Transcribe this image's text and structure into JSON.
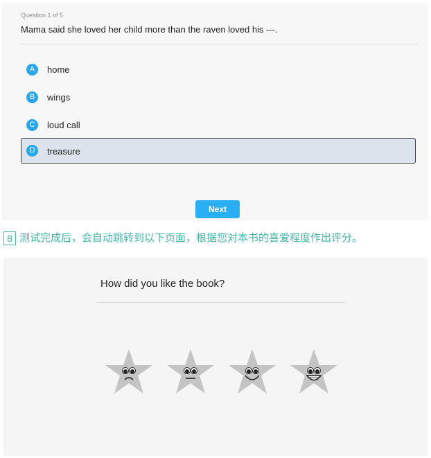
{
  "quiz": {
    "counter": "Question 1 of 5",
    "question": "Mama said she loved her child more than the raven loved his ---.",
    "options": [
      {
        "letter": "A",
        "label": "home"
      },
      {
        "letter": "B",
        "label": "wings"
      },
      {
        "letter": "C",
        "label": "loud call"
      },
      {
        "letter": "D",
        "label": "treasure"
      }
    ],
    "selected": "D",
    "next_label": "Next"
  },
  "instruction": {
    "step": "8",
    "text": "测试完成后，会自动跳转到以下页面，根据您对本书的喜爱程度作出评分。"
  },
  "rating": {
    "title": "How did you like the book?",
    "stars": [
      {
        "icon": "sad-star-icon"
      },
      {
        "icon": "neutral-star-icon"
      },
      {
        "icon": "happy-star-icon"
      },
      {
        "icon": "very-happy-star-icon"
      }
    ]
  },
  "colors": {
    "accent": "#2aa7ea",
    "button": "#2aaef4",
    "instruction_text": "#41b4a6",
    "selected_bg": "#dce3ec",
    "star_fill": "#c4c4c4"
  }
}
